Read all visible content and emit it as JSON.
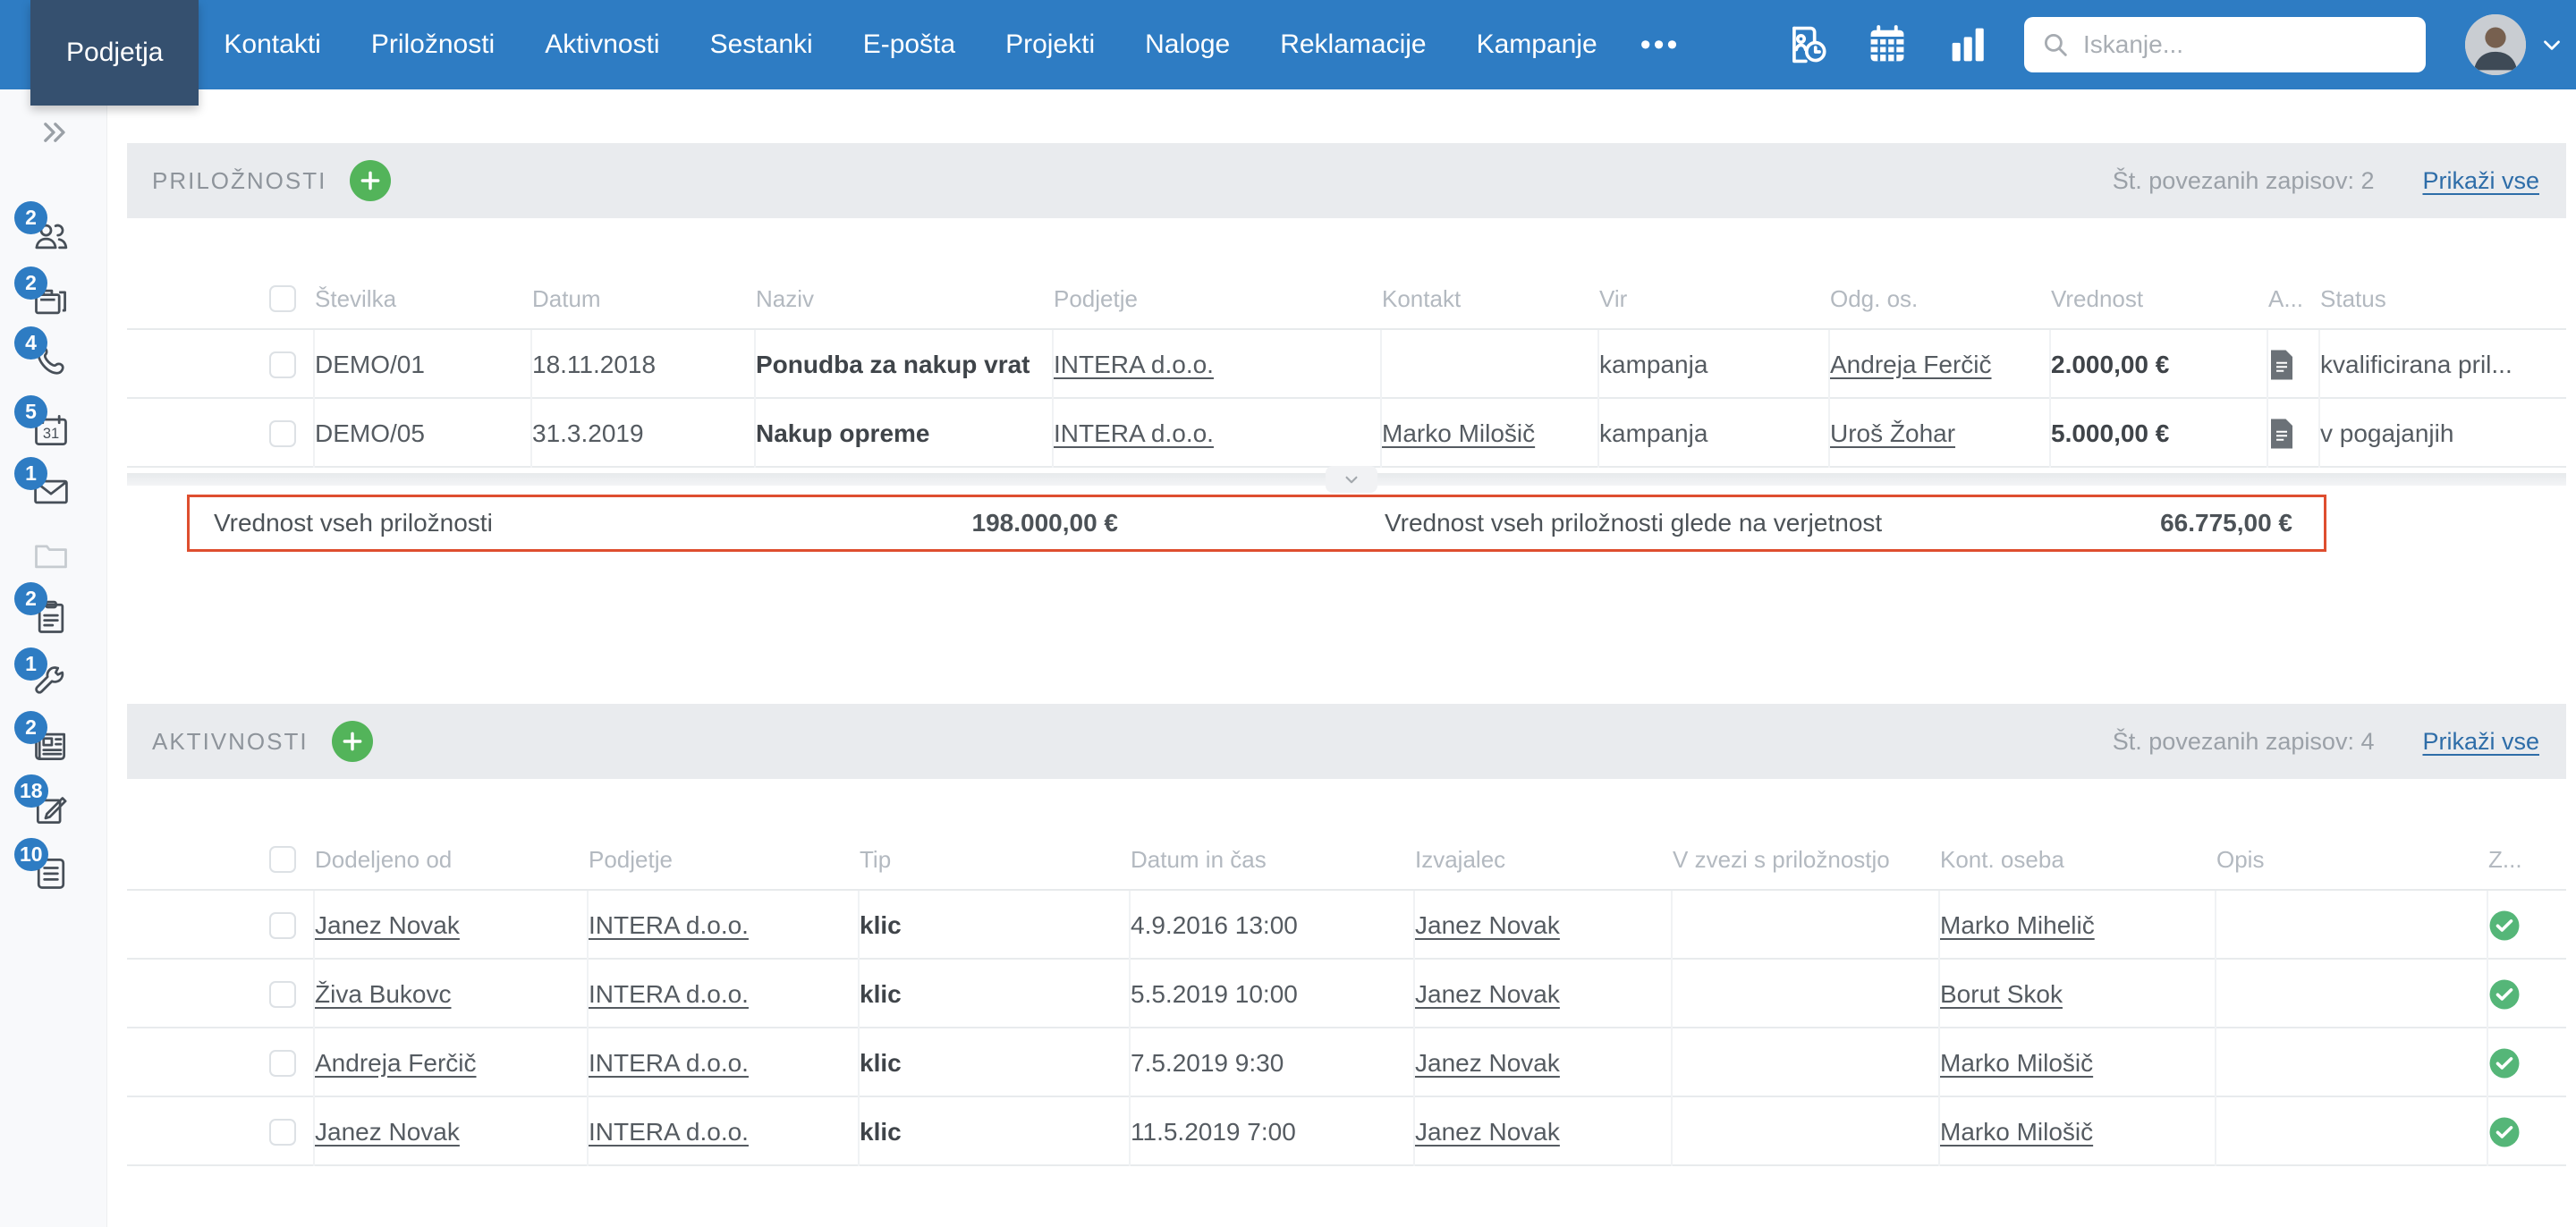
{
  "nav": {
    "tabs": [
      {
        "label": "Podjetja",
        "active": true
      },
      {
        "label": "Kontakti",
        "active": false
      },
      {
        "label": "Priložnosti",
        "active": false
      },
      {
        "label": "Aktivnosti",
        "active": false
      },
      {
        "label": "Sestanki",
        "active": false
      },
      {
        "label": "E-pošta",
        "active": false
      },
      {
        "label": "Projekti",
        "active": false
      },
      {
        "label": "Naloge",
        "active": false
      },
      {
        "label": "Reklamacije",
        "active": false
      },
      {
        "label": "Kampanje",
        "active": false
      }
    ],
    "more_label": "•••",
    "search_placeholder": "Iskanje...",
    "toolbar_icons": [
      "recent-contacts-icon",
      "calendar-grid-icon",
      "bar-chart-icon"
    ],
    "user_menu_icon": "chevron-down-icon"
  },
  "sidebar": {
    "collapse_icon": "chevron-double-right-icon",
    "items": [
      {
        "icon": "people-icon",
        "badge": "2"
      },
      {
        "icon": "briefcase-icon",
        "badge": "2"
      },
      {
        "icon": "phone-icon",
        "badge": "4"
      },
      {
        "icon": "calendar-31-icon",
        "badge": "5"
      },
      {
        "icon": "envelope-icon",
        "badge": "1"
      },
      {
        "icon": "folder-icon",
        "badge": null
      },
      {
        "icon": "clipboard-icon",
        "badge": "2"
      },
      {
        "icon": "wrench-icon",
        "badge": "1"
      },
      {
        "icon": "newspaper-icon",
        "badge": "2"
      },
      {
        "icon": "edit-icon",
        "badge": "18"
      },
      {
        "icon": "notes-icon",
        "badge": "10"
      }
    ]
  },
  "opportunities": {
    "title": "PRILOŽNOSTI",
    "records_count_label": "Št. povezanih zapisov: 2",
    "show_all_label": "Prikaži vse",
    "columns": [
      "Številka",
      "Datum",
      "Naziv",
      "Podjetje",
      "Kontakt",
      "Vir",
      "Odg. os.",
      "Vrednost",
      "A...",
      "Status"
    ],
    "rows": [
      {
        "stevilka": "DEMO/01",
        "datum": "18.11.2018",
        "naziv": "Ponudba za nakup vrat",
        "podjetje": "INTERA d.o.o.",
        "kontakt": "",
        "vir": "kampanja",
        "odg_os": "Andreja Ferčič",
        "vrednost": "2.000,00 €",
        "attachment_icon": "document-icon",
        "status": "kvalificirana pril..."
      },
      {
        "stevilka": "DEMO/05",
        "datum": "31.3.2019",
        "naziv": "Nakup opreme",
        "podjetje": "INTERA d.o.o.",
        "kontakt": "Marko Milošič",
        "vir": "kampanja",
        "odg_os": "Uroš Žohar",
        "vrednost": "5.000,00 €",
        "attachment_icon": "document-icon",
        "status": "v pogajanjih"
      }
    ],
    "summary": {
      "label_total": "Vrednost vseh priložnosti",
      "value_total": "198.000,00 €",
      "label_weighted": "Vrednost vseh priložnosti glede na verjetnost",
      "value_weighted": "66.775,00 €"
    }
  },
  "activities": {
    "title": "AKTIVNOSTI",
    "records_count_label": "Št. povezanih zapisov: 4",
    "show_all_label": "Prikaži vse",
    "columns": [
      "Dodeljeno od",
      "Podjetje",
      "Tip",
      "Datum in čas",
      "Izvajalec",
      "V zvezi s priložnostjo",
      "Kont. oseba",
      "Opis",
      "Z..."
    ],
    "rows": [
      {
        "dodeljeno_od": "Janez Novak",
        "podjetje": "INTERA d.o.o.",
        "tip": "klic",
        "datum_cas": "4.9.2016 13:00",
        "izvajalec": "Janez Novak",
        "v_zvezi": "",
        "kont_oseba": "Marko Mihelič",
        "opis": "",
        "done_icon": "check-circle-icon"
      },
      {
        "dodeljeno_od": "Živa Bukovc",
        "podjetje": "INTERA d.o.o.",
        "tip": "klic",
        "datum_cas": "5.5.2019 10:00",
        "izvajalec": "Janez Novak",
        "v_zvezi": "",
        "kont_oseba": "Borut Skok",
        "opis": "",
        "done_icon": "check-circle-icon"
      },
      {
        "dodeljeno_od": "Andreja Ferčič",
        "podjetje": "INTERA d.o.o.",
        "tip": "klic",
        "datum_cas": "7.5.2019 9:30",
        "izvajalec": "Janez Novak",
        "v_zvezi": "",
        "kont_oseba": "Marko Milošič",
        "opis": "",
        "done_icon": "check-circle-icon"
      },
      {
        "dodeljeno_od": "Janez Novak",
        "podjetje": "INTERA d.o.o.",
        "tip": "klic",
        "datum_cas": "11.5.2019 7:00",
        "izvajalec": "Janez Novak",
        "v_zvezi": "",
        "kont_oseba": "Marko Milošič",
        "opis": "",
        "done_icon": "check-circle-icon"
      }
    ]
  },
  "colors": {
    "nav_blue": "#2E7CC3",
    "active_tab_navy": "#35506F",
    "badge_blue": "#2E7CC3",
    "add_button_green": "#53B45A",
    "check_green": "#55B678",
    "summary_border_red": "#DE4E2F",
    "link_blue": "#2E6DA8",
    "section_bar_gray": "#E9EBEE"
  }
}
